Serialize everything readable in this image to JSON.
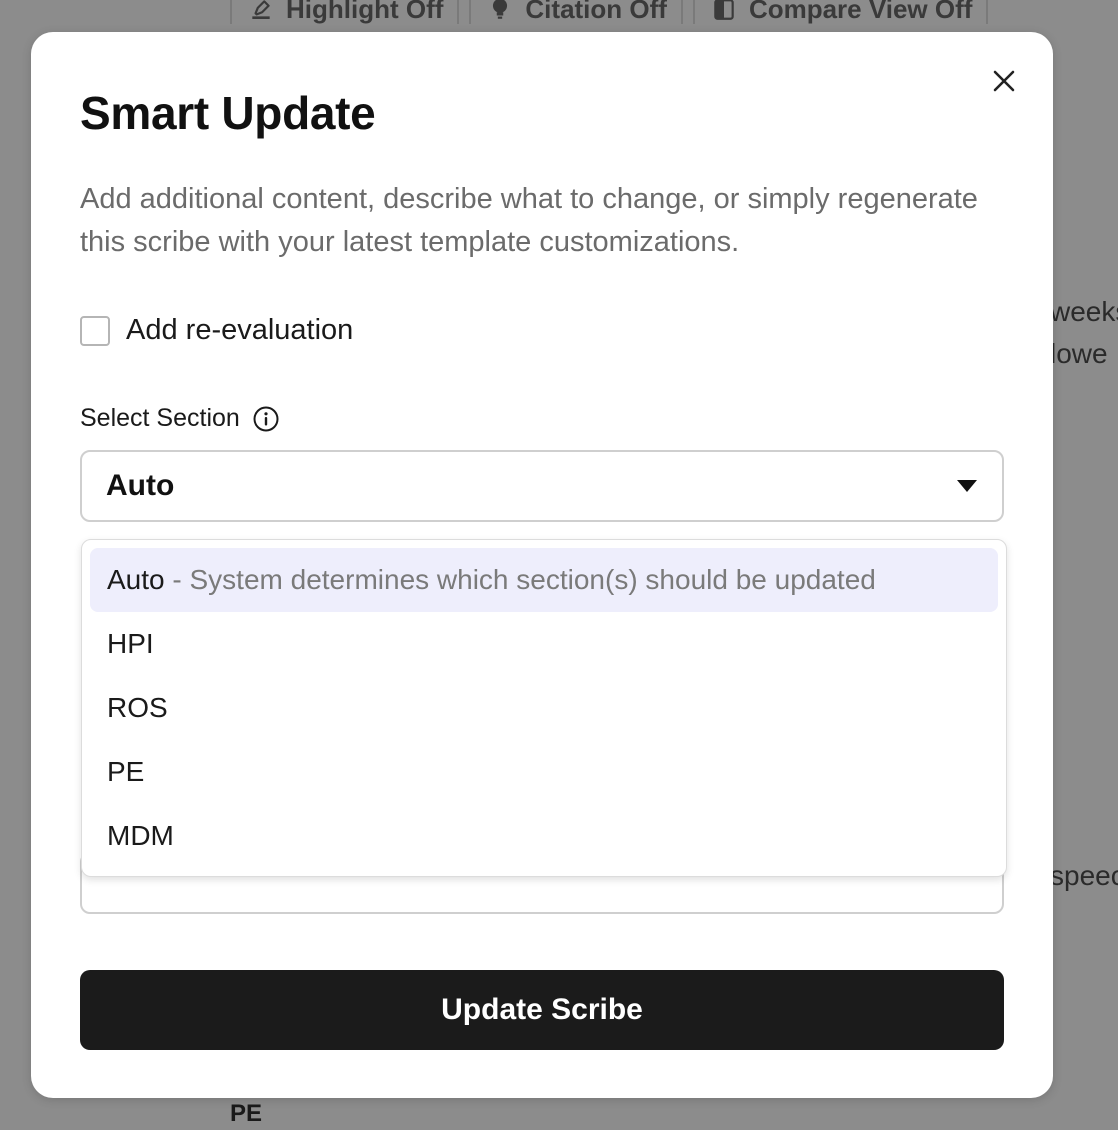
{
  "background": {
    "toolbar": [
      {
        "icon": "highlighter-icon",
        "label": "Highlight Off"
      },
      {
        "icon": "lightbulb-icon",
        "label": "Citation Off"
      },
      {
        "icon": "compare-icon",
        "label": "Compare View Off"
      }
    ],
    "fragments": [
      "weeks",
      "lowe",
      "speec"
    ],
    "pe_label": "PE"
  },
  "modal": {
    "title": "Smart Update",
    "description": "Add additional content, describe what to change, or simply regenerate this scribe with your latest template customizations.",
    "reevaluation": {
      "label": "Add re-evaluation",
      "checked": false
    },
    "section": {
      "label": "Select Section",
      "selected": "Auto",
      "options": [
        {
          "label": "Auto",
          "separator": " - ",
          "description": "System determines which section(s) should be updated",
          "selected": true
        },
        {
          "label": "HPI"
        },
        {
          "label": "ROS"
        },
        {
          "label": "PE"
        },
        {
          "label": "MDM"
        }
      ]
    },
    "submit_label": "Update Scribe"
  },
  "colors": {
    "overlay": "#8c8c8c",
    "button": "#1b1b1b",
    "selected_option": "#eeeefc"
  }
}
